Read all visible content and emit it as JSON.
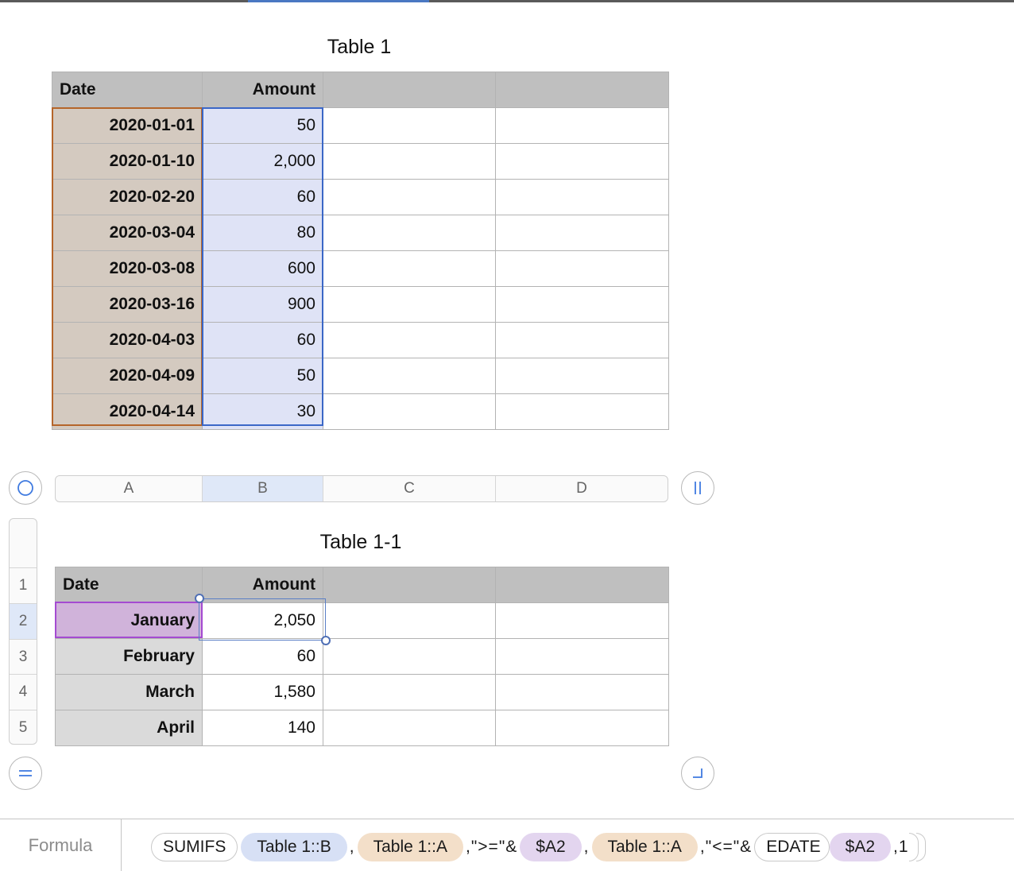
{
  "table1": {
    "title": "Table 1",
    "headers": [
      "Date",
      "Amount",
      "",
      ""
    ],
    "rows": [
      {
        "date": "2020-01-01",
        "amount": "50"
      },
      {
        "date": "2020-01-10",
        "amount": "2,000"
      },
      {
        "date": "2020-02-20",
        "amount": "60"
      },
      {
        "date": "2020-03-04",
        "amount": "80"
      },
      {
        "date": "2020-03-08",
        "amount": "600"
      },
      {
        "date": "2020-03-16",
        "amount": "900"
      },
      {
        "date": "2020-04-03",
        "amount": "60"
      },
      {
        "date": "2020-04-09",
        "amount": "50"
      },
      {
        "date": "2020-04-14",
        "amount": "30"
      }
    ]
  },
  "column_bar": [
    "A",
    "B",
    "C",
    "D"
  ],
  "row_bar": [
    "1",
    "2",
    "3",
    "4",
    "5"
  ],
  "table2": {
    "title": "Table 1-1",
    "headers": [
      "Date",
      "Amount",
      "",
      ""
    ],
    "rows": [
      {
        "month": "January",
        "amount": "2,050"
      },
      {
        "month": "February",
        "amount": "60"
      },
      {
        "month": "March",
        "amount": "1,580"
      },
      {
        "month": "April",
        "amount": "140"
      }
    ]
  },
  "formula_bar": {
    "label": "Formula",
    "function": "SUMIFS",
    "ref1": "Table 1::B",
    "sep1": ",",
    "ref2": "Table 1::A",
    "literal1": ",\">=\"&",
    "ref3": "$A2",
    "sep2": ",",
    "ref4": "Table 1::A",
    "literal2": ",\"<=\"&",
    "function2": "EDATE",
    "ref5": "$A2",
    "literal3": ",1"
  },
  "colors": {
    "accent": "#4a78c2",
    "date_ref": "#b5652a",
    "amount_ref": "#3b67c7",
    "cell_ref": "#a44bd1"
  },
  "icons": [
    "select-table-icon",
    "column-freeze-icon",
    "row-freeze-icon",
    "resize-table-icon"
  ]
}
